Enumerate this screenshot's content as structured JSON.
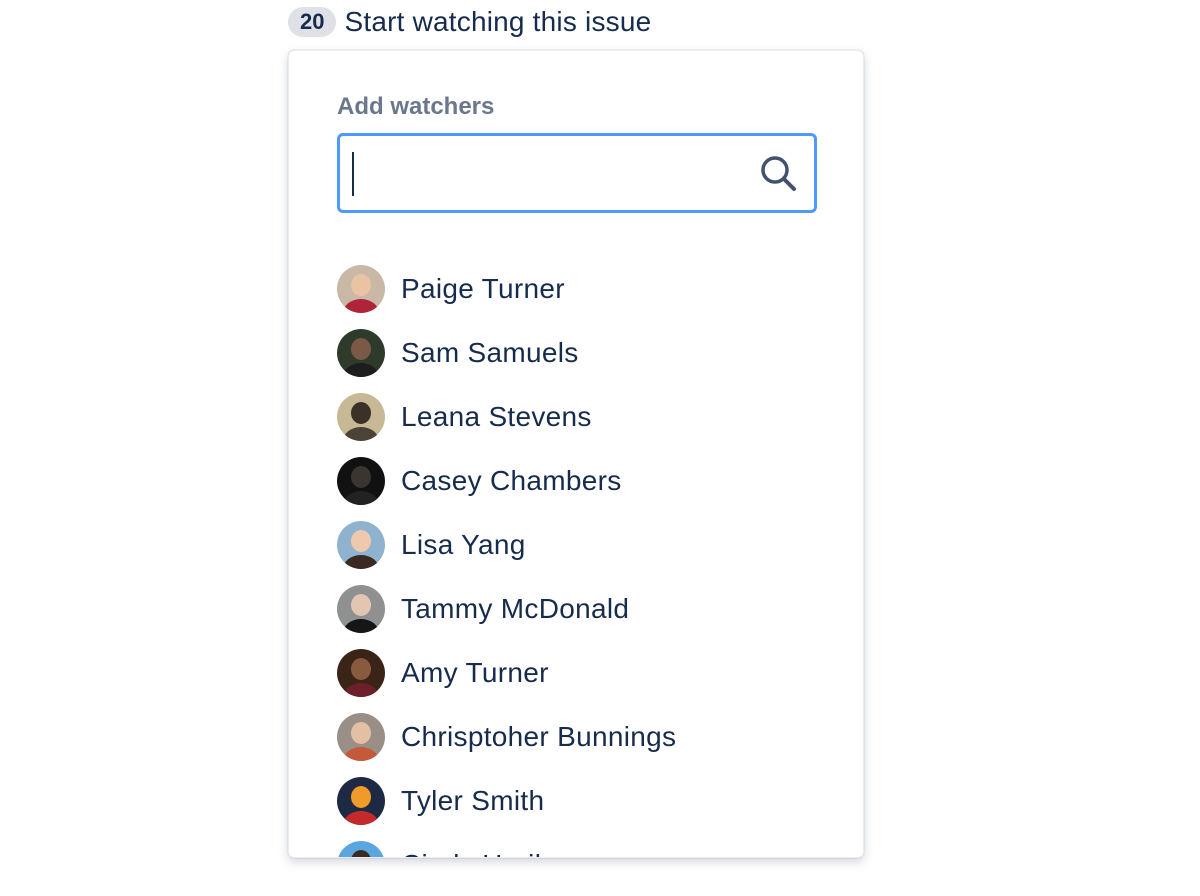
{
  "watch": {
    "count": "20",
    "label": "Start watching this issue"
  },
  "dropdown": {
    "heading": "Add watchers",
    "search": {
      "value": "",
      "placeholder": "",
      "icon": "search-icon"
    },
    "users": [
      {
        "name": "Paige Turner",
        "avatar": {
          "bg": "#c9b8a6",
          "face": "#e9c3a4",
          "body": "#b0243a"
        }
      },
      {
        "name": "Sam Samuels",
        "avatar": {
          "bg": "#2f3b2a",
          "face": "#7a5a46",
          "body": "#1d1d1d"
        }
      },
      {
        "name": "Leana Stevens",
        "avatar": {
          "bg": "#c8b996",
          "face": "#3a3128",
          "body": "#4b4436"
        }
      },
      {
        "name": "Casey Chambers",
        "avatar": {
          "bg": "#111111",
          "face": "#3b3530",
          "body": "#222222"
        }
      },
      {
        "name": "Lisa Yang",
        "avatar": {
          "bg": "#8fb3cf",
          "face": "#efc9ad",
          "body": "#3b2a22"
        }
      },
      {
        "name": "Tammy McDonald",
        "avatar": {
          "bg": "#8e9190",
          "face": "#e2c6b2",
          "body": "#161616"
        }
      },
      {
        "name": "Amy Turner",
        "avatar": {
          "bg": "#3a2418",
          "face": "#8a5a3e",
          "body": "#6d1f2a"
        }
      },
      {
        "name": "Chrisptoher Bunnings",
        "avatar": {
          "bg": "#9a8f86",
          "face": "#e3c0a4",
          "body": "#c45a3a"
        }
      },
      {
        "name": "Tyler Smith",
        "avatar": {
          "bg": "#1e2a44",
          "face": "#f09a2a",
          "body": "#c52a2a"
        }
      },
      {
        "name": "Cindy Haribo",
        "avatar": {
          "bg": "#5aa6e0",
          "face": "#3a2a22",
          "body": "#c9e3f4"
        }
      }
    ]
  }
}
